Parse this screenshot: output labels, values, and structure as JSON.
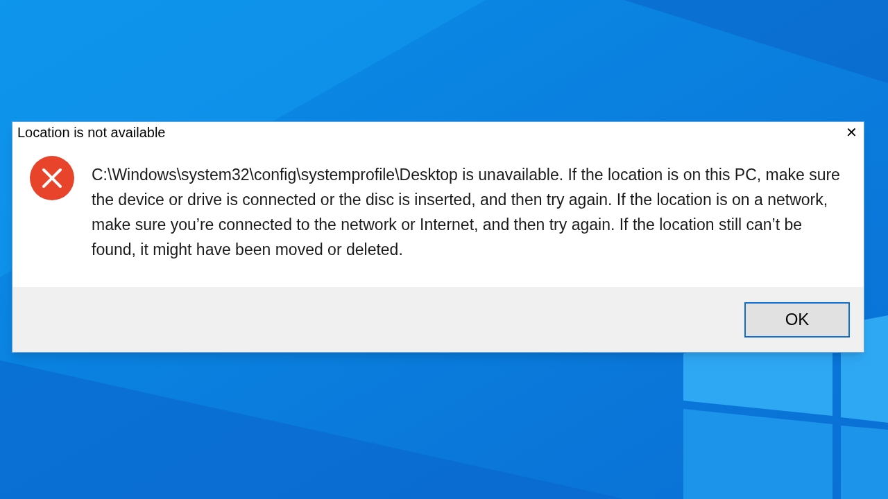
{
  "dialog": {
    "title": "Location is not available",
    "close": "✕",
    "message": "C:\\Windows\\system32\\config\\systemprofile\\Desktop is unavailable. If the location is on this PC, make sure the device or drive is connected or the disc is inserted, and then try again. If the location is on a network, make sure you’re connected to the network or Internet, and then try again. If the location still can’t be found, it might have been moved or deleted.",
    "buttons": [
      "OK"
    ]
  }
}
